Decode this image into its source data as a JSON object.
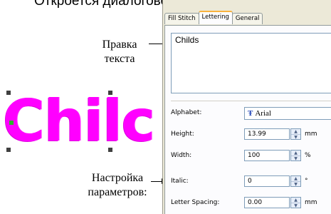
{
  "caption": "Откроется диалоговое окно Obje",
  "canvas": {
    "stitched_text": "Chilc"
  },
  "annotations": {
    "edit_text_line1": "Правка",
    "edit_text_line2": "текста",
    "settings_line1": "Настройка",
    "settings_line2": "параметров:"
  },
  "dialog": {
    "tabs": [
      "Fill Stitch",
      "Lettering",
      "General"
    ],
    "active_tab": "Lettering",
    "text_value": "Childs",
    "fields": {
      "alphabet": {
        "label": "Alphabet:",
        "value": "Arial",
        "icon": "truetype-font-icon"
      },
      "height": {
        "label": "Height:",
        "value": "13.99",
        "unit": "mm"
      },
      "width": {
        "label": "Width:",
        "value": "100",
        "unit": "%"
      },
      "italic": {
        "label": "Italic:",
        "value": "0",
        "unit": "°"
      },
      "letter_spacing": {
        "label": "Letter Spacing:",
        "value": "0.00",
        "unit": "mm"
      }
    }
  },
  "colors": {
    "stitch": "#ff00ff",
    "dialog_bg": "#ece9d8",
    "field_border": "#7f9db9"
  }
}
